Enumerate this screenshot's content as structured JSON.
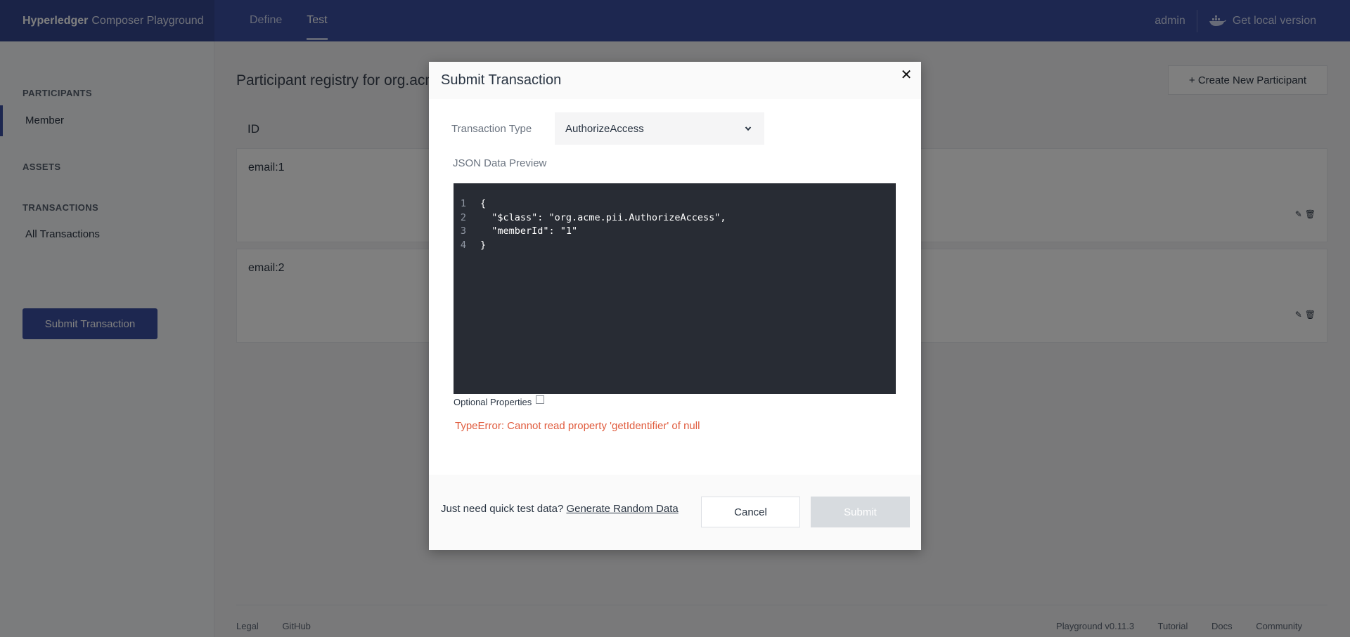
{
  "app": {
    "brand_bold": "Hyperledger",
    "brand_rest": "Composer Playground"
  },
  "nav": {
    "define": "Define",
    "test": "Test"
  },
  "top_right": {
    "user": "admin",
    "get_local": "Get local version"
  },
  "sidebar": {
    "participants_heading": "PARTICIPANTS",
    "participant_item": "Member",
    "assets_heading": "ASSETS",
    "transactions_heading": "TRANSACTIONS",
    "transactions_item": "All Transactions",
    "submit_button": "Submit Transaction"
  },
  "main": {
    "title": "Participant registry for org.acme.pii.Member",
    "create_button": "+ Create New Participant",
    "id_header": "ID",
    "rows": [
      {
        "id": "email:1"
      },
      {
        "id": "email:2"
      }
    ]
  },
  "footer": {
    "legal": "Legal",
    "github": "GitHub",
    "version": "Playground v0.11.3",
    "tutorial": "Tutorial",
    "docs": "Docs",
    "community": "Community"
  },
  "modal": {
    "title": "Submit Transaction",
    "close_glyph": "✕",
    "tx_type_label": "Transaction Type",
    "tx_type_value": "AuthorizeAccess",
    "json_label": "JSON Data Preview",
    "code_lines": [
      {
        "n": "1",
        "text": "{"
      },
      {
        "n": "2",
        "text": "  \"$class\": \"org.acme.pii.AuthorizeAccess\","
      },
      {
        "n": "3",
        "text": "  \"memberId\": \"1\""
      },
      {
        "n": "4",
        "text": "}"
      }
    ],
    "optional_label": "Optional Properties",
    "optional_checked": false,
    "error": "TypeError: Cannot read property 'getIdentifier' of null",
    "quick_text": "Just need quick test data?",
    "quick_link": "Generate Random Data",
    "cancel": "Cancel",
    "submit": "Submit"
  },
  "colors": {
    "topbar": "#3b4ea0",
    "error": "#e05c3e",
    "editor_bg": "#282c34",
    "submit_disabled": "#d7dbdf"
  }
}
